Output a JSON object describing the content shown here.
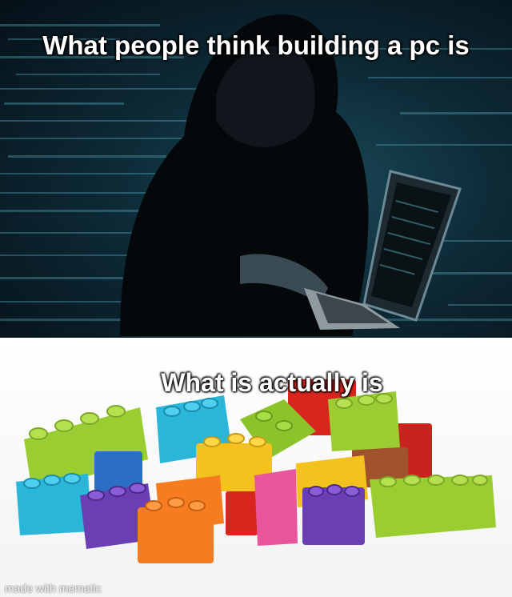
{
  "meme": {
    "top_caption": "What people think building a pc is",
    "bottom_caption": "What is actually is",
    "watermark": "made with mematic"
  },
  "top_panel": {
    "subject": "hooded-hacker-with-laptop-icon",
    "background_color": "#0d2a36",
    "code_color": "#5fb3c8"
  },
  "bottom_panel": {
    "subject": "colorful-toy-bricks-icon",
    "brick_colors": [
      "#9acd32",
      "#29b6d9",
      "#f4c21f",
      "#f57c1f",
      "#6a3fb4",
      "#e8559b",
      "#d8261f",
      "#a0522d"
    ]
  }
}
